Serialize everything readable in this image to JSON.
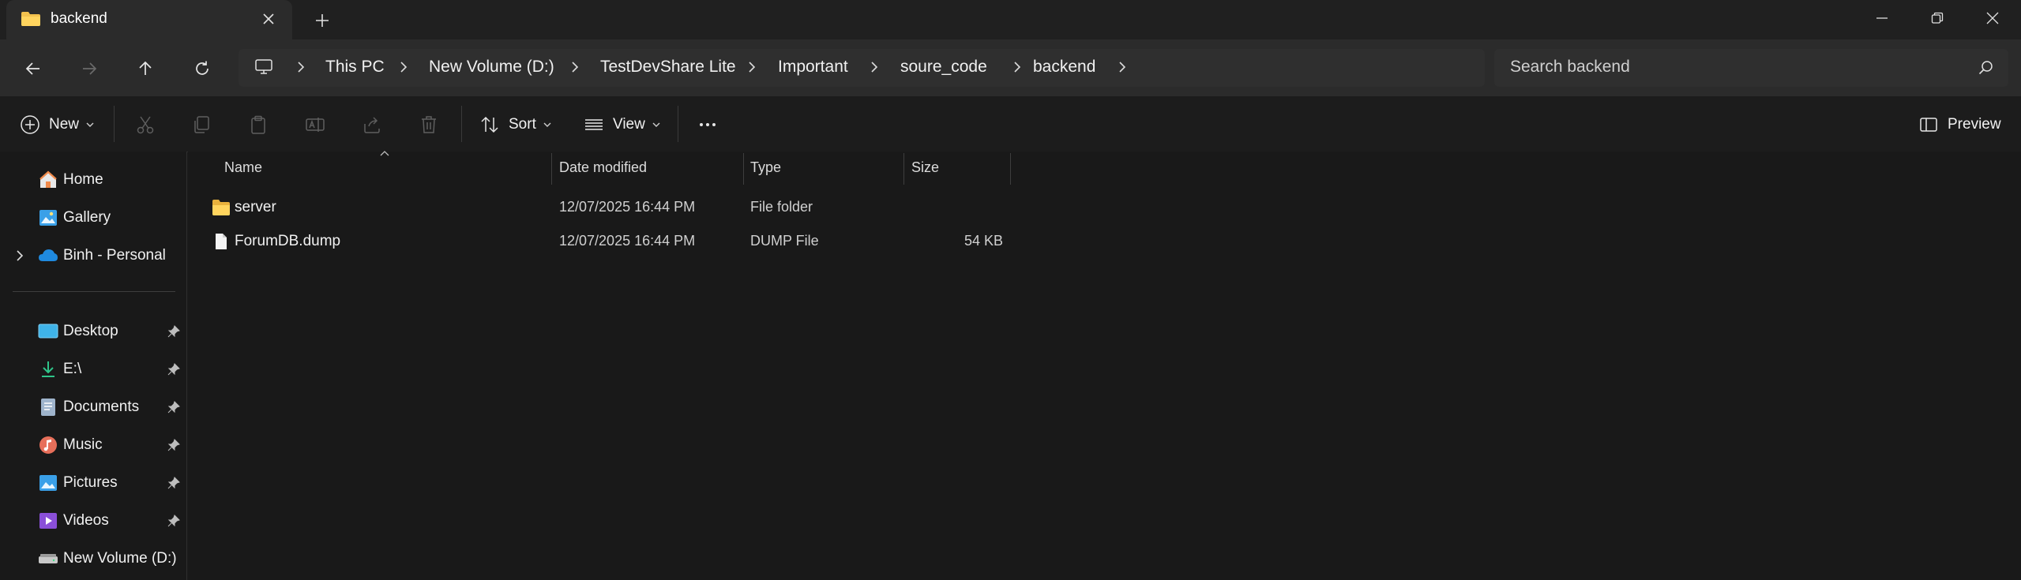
{
  "tab": {
    "title": "backend"
  },
  "breadcrumb": [
    "This PC",
    "New Volume (D:)",
    "TestDevShare Lite",
    "Important",
    "soure_code",
    "backend"
  ],
  "search": {
    "placeholder": "Search backend"
  },
  "toolbar": {
    "new_label": "New",
    "sort_label": "Sort",
    "view_label": "View",
    "preview_label": "Preview"
  },
  "sidebar": {
    "top": [
      {
        "label": "Home",
        "icon": "home-icon"
      },
      {
        "label": "Gallery",
        "icon": "gallery-icon"
      },
      {
        "label": "Binh - Personal",
        "icon": "onedrive-cloud-icon"
      }
    ],
    "pinned": [
      {
        "label": "Desktop",
        "icon": "desktop-icon"
      },
      {
        "label": "E:\\",
        "icon": "download-icon"
      },
      {
        "label": "Documents",
        "icon": "documents-icon"
      },
      {
        "label": "Music",
        "icon": "music-icon"
      },
      {
        "label": "Pictures",
        "icon": "pictures-icon"
      },
      {
        "label": "Videos",
        "icon": "videos-icon"
      }
    ],
    "drives": [
      {
        "label": "New Volume (D:)",
        "icon": "drive-icon"
      }
    ]
  },
  "columns": {
    "name": "Name",
    "date": "Date modified",
    "type": "Type",
    "size": "Size"
  },
  "files": [
    {
      "name": "server",
      "date": "12/07/2025 16:44 PM",
      "type": "File folder",
      "size": "",
      "icon": "folder-icon"
    },
    {
      "name": "ForumDB.dump",
      "date": "12/07/2025 16:44 PM",
      "type": "DUMP File",
      "size": "54 KB",
      "icon": "file-icon"
    }
  ],
  "colors": {
    "folder": "#f2c14e",
    "accent": "#4cc2ff",
    "background": "#191919"
  }
}
